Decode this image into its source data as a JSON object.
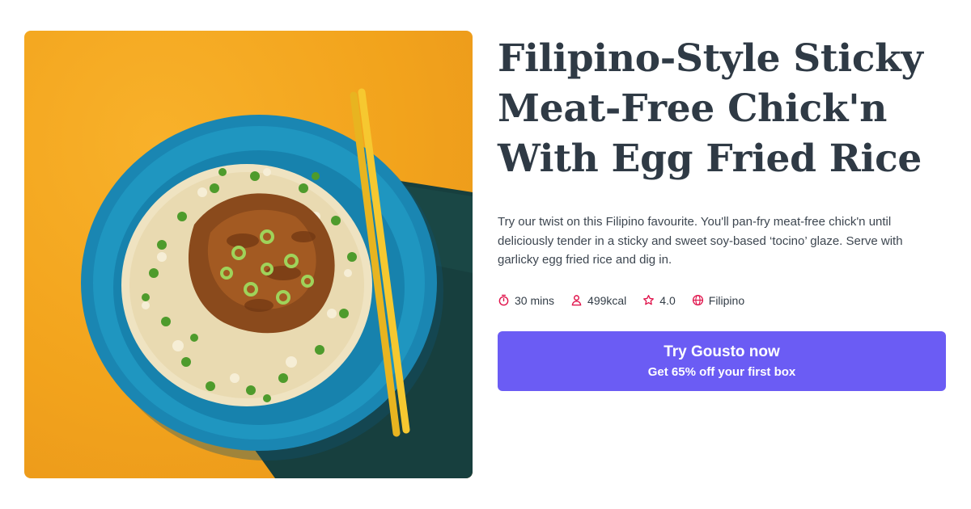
{
  "recipe": {
    "title": "Filipino-Style Sticky Meat-Free Chick'n With Egg Fried Rice",
    "description": "Try our twist on this Filipino favourite. You'll pan-fry meat-free chick'n until deliciously tender in a sticky and sweet soy-based ‘tocino’ glaze. Serve with garlicky egg fried rice and dig in.",
    "meta": {
      "time": "30 mins",
      "calories": "499kcal",
      "rating": "4.0",
      "cuisine": "Filipino"
    },
    "icons": {
      "time": "timer-icon",
      "calories": "person-icon",
      "rating": "star-icon",
      "cuisine": "globe-icon"
    }
  },
  "cta": {
    "title": "Try Gousto now",
    "subtitle": "Get 65% off your first box"
  },
  "colors": {
    "accent": "#6b5cf4",
    "icon": "#e0134b",
    "title": "#2f3a45",
    "background_orange": "#f2a31c",
    "bowl": "#1e88b0",
    "napkin": "#1a4a48",
    "chopsticks": "#f3c12b"
  }
}
